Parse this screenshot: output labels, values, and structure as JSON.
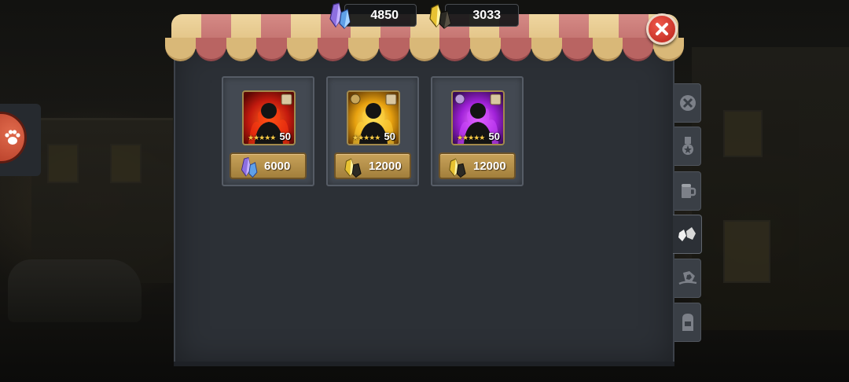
{
  "currencies": [
    {
      "name": "purple-crystal",
      "value": "4850"
    },
    {
      "name": "gold-crystal",
      "value": "3033"
    }
  ],
  "shop_items": [
    {
      "frame_color": "red",
      "level": "50",
      "stars": "★★★★★",
      "currency": "purple-crystal",
      "price": "6000"
    },
    {
      "frame_color": "gold",
      "level": "50",
      "stars": "★★★★★",
      "currency": "gold-crystal",
      "price": "12000"
    },
    {
      "frame_color": "purple",
      "level": "50",
      "stars": "★★★★★",
      "currency": "gold-crystal",
      "price": "12000"
    }
  ],
  "side_tabs": [
    {
      "icon": "crossed-swords-icon",
      "active": false
    },
    {
      "icon": "medal-icon",
      "active": false
    },
    {
      "icon": "beer-mug-icon",
      "active": false
    },
    {
      "icon": "crystals-icon",
      "active": true
    },
    {
      "icon": "gem-hand-icon",
      "active": false
    },
    {
      "icon": "backpack-icon",
      "active": false
    }
  ],
  "colors": {
    "panel": "#2c3036",
    "awning_cream": "#efd6a0",
    "awning_pink": "#c97a77",
    "price_button": "#b8924c",
    "close_button": "#d8352a"
  }
}
